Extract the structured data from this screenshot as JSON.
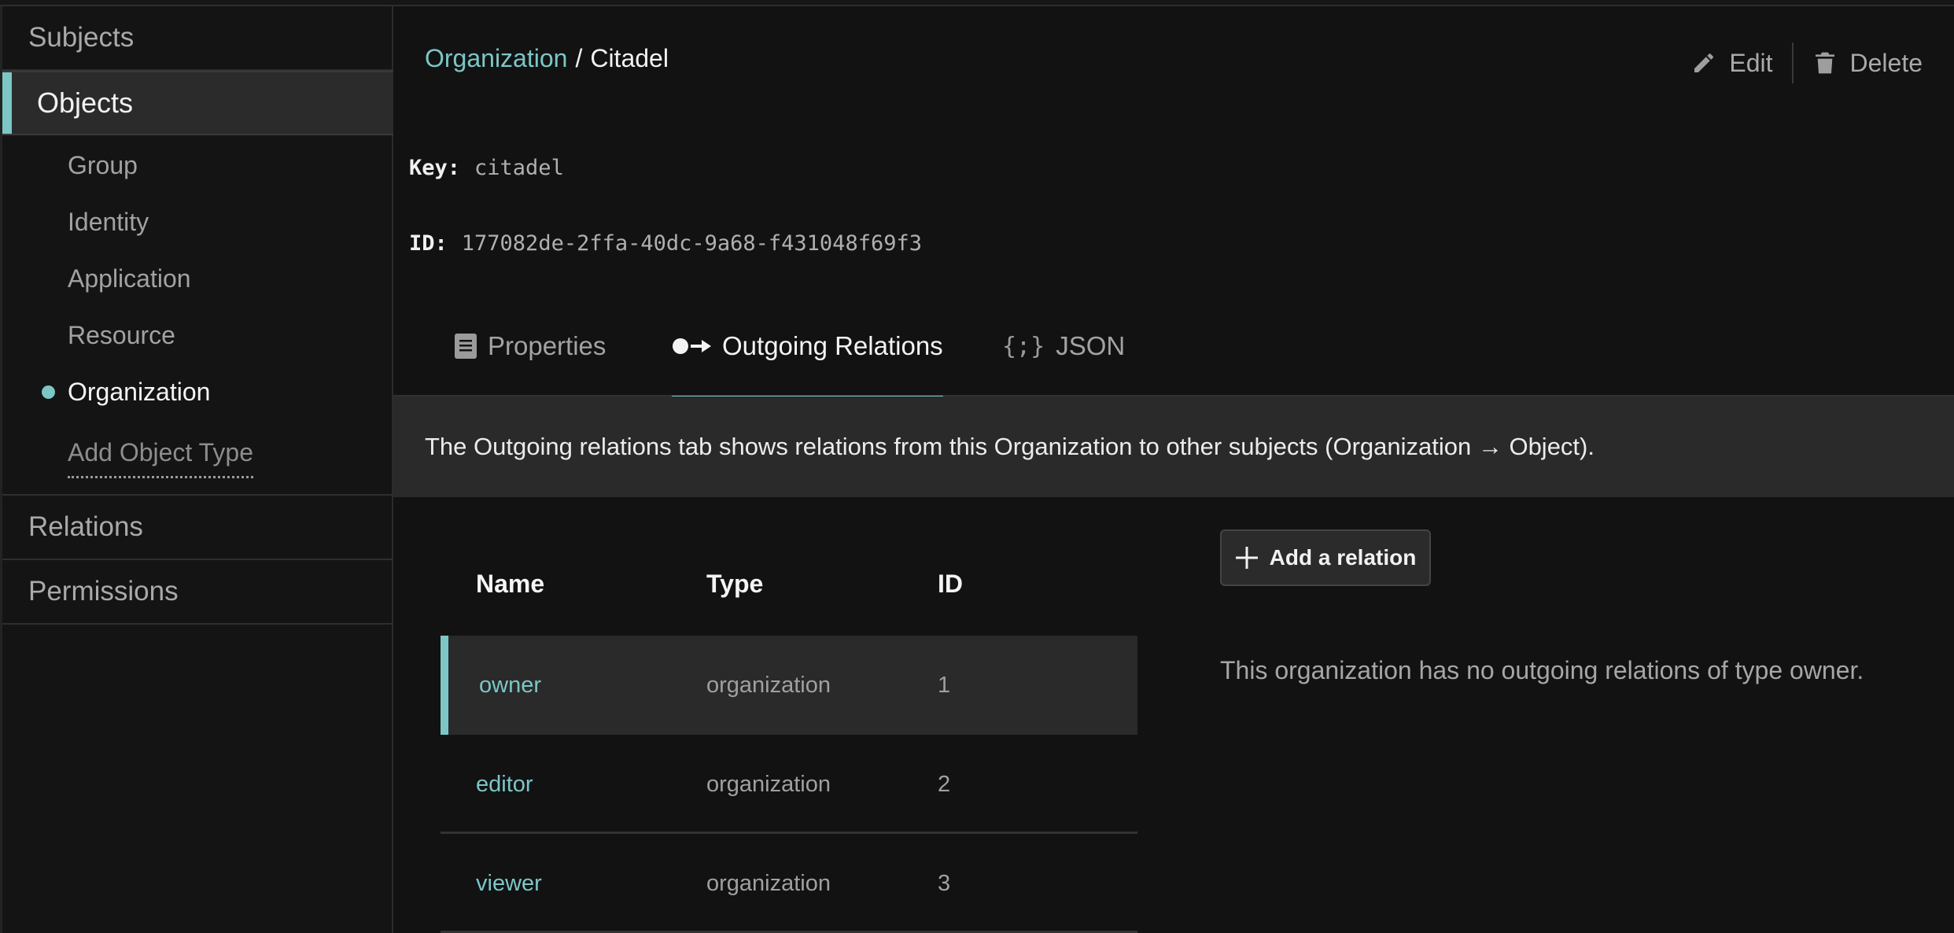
{
  "sidebar": {
    "subjects_label": "Subjects",
    "objects_label": "Objects",
    "object_types": [
      {
        "label": "Group"
      },
      {
        "label": "Identity"
      },
      {
        "label": "Application"
      },
      {
        "label": "Resource"
      },
      {
        "label": "Organization"
      }
    ],
    "add_object_type_label": "Add Object Type",
    "relations_label": "Relations",
    "permissions_label": "Permissions"
  },
  "breadcrumb": {
    "parent": "Organization",
    "separator": "/",
    "current": "Citadel"
  },
  "actions": {
    "edit_label": "Edit",
    "delete_label": "Delete"
  },
  "details": {
    "key_label": "Key:",
    "key_value": "citadel",
    "id_label": "ID:",
    "id_value": "177082de-2ffa-40dc-9a68-f431048f69f3"
  },
  "tabs": [
    {
      "label": "Properties",
      "icon": "document-icon"
    },
    {
      "label": "Outgoing Relations",
      "icon": "dot-arrow-icon"
    },
    {
      "label": "JSON",
      "icon": "braces-icon"
    }
  ],
  "active_tab": "Outgoing Relations",
  "banner_text": "The Outgoing relations tab shows relations from this Organization to other subjects (Organization → Object).",
  "relations_table": {
    "headers": {
      "name": "Name",
      "type": "Type",
      "id": "ID"
    },
    "rows": [
      {
        "name": "owner",
        "type": "organization",
        "id": "1"
      },
      {
        "name": "editor",
        "type": "organization",
        "id": "2"
      },
      {
        "name": "viewer",
        "type": "organization",
        "id": "3"
      }
    ]
  },
  "add_relation_label": "Add a relation",
  "empty_message": "This organization has no outgoing relations of type owner.",
  "colors": {
    "accent": "#7cc6c6",
    "background": "#121212",
    "panel": "#2a2a2a"
  }
}
